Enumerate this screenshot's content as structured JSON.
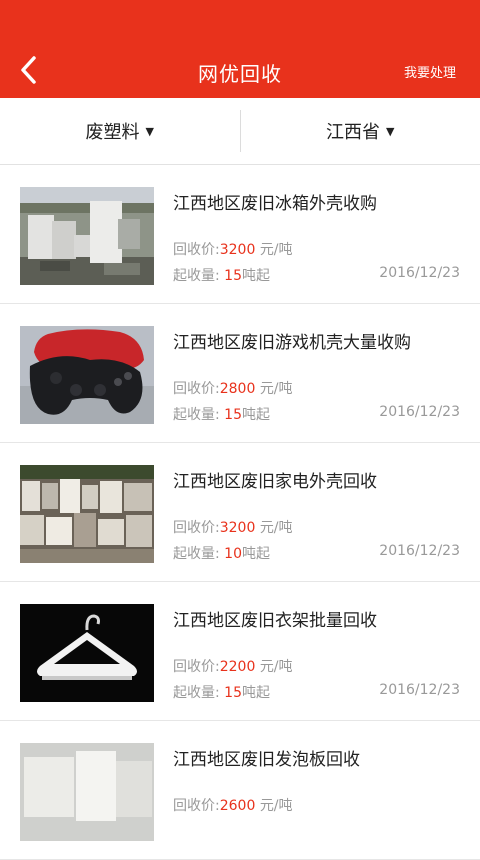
{
  "header": {
    "title": "网优回收",
    "action_label": "我要处理",
    "back_icon": "chevron-left-icon",
    "color": "#e8321c"
  },
  "filters": [
    {
      "label": "废塑料",
      "icon": "triangle-down-icon"
    },
    {
      "label": "江西省",
      "icon": "triangle-down-icon"
    }
  ],
  "listing_labels": {
    "price_label": "回收价:",
    "price_unit": "元/吨",
    "qty_label": "起收量:",
    "qty_unit": "吨起"
  },
  "listings": [
    {
      "title": "江西地区废旧冰箱外壳收购",
      "price": "3200",
      "qty": "15",
      "date": "2016/12/23",
      "image": "refrigerator-scrap-photo"
    },
    {
      "title": "江西地区废旧游戏机壳大量收购",
      "price": "2800",
      "qty": "15",
      "date": "2016/12/23",
      "image": "game-controller-photo"
    },
    {
      "title": "江西地区废旧家电外壳回收",
      "price": "3200",
      "qty": "10",
      "date": "2016/12/23",
      "image": "appliance-pile-photo"
    },
    {
      "title": "江西地区废旧衣架批量回收",
      "price": "2200",
      "qty": "15",
      "date": "2016/12/23",
      "image": "clothes-hanger-photo"
    },
    {
      "title": "江西地区废旧发泡板回收",
      "price": "2600",
      "qty": "",
      "date": "",
      "image": "foam-board-photo"
    }
  ]
}
